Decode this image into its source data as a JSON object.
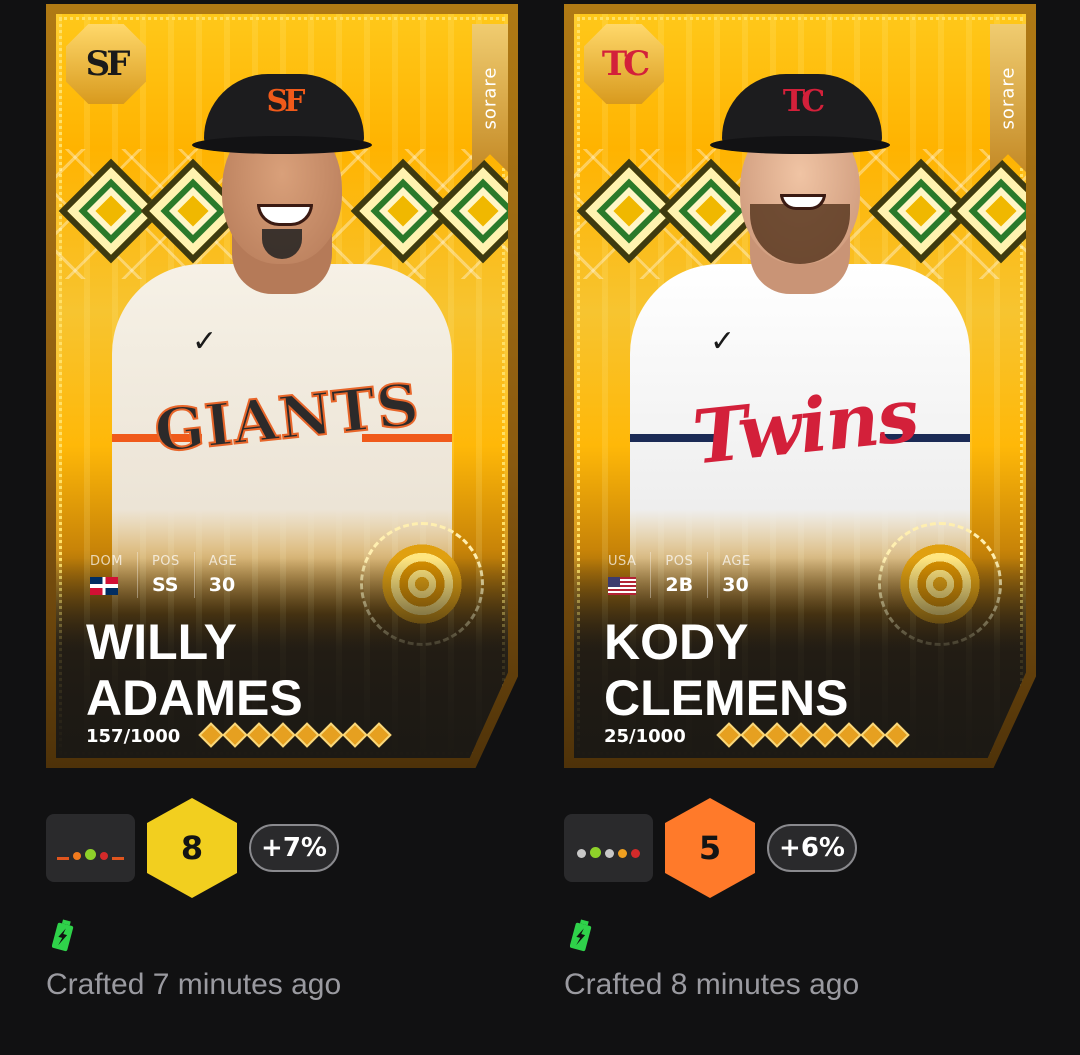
{
  "brand": "sorare",
  "cards": [
    {
      "team_logo_icon": "sf-giants-logo-icon",
      "team_logo_text": "SF",
      "team_color": "#f05a1a",
      "jersey_wordmark": "GIANTS",
      "nationality": "DOM",
      "pos_label": "POS",
      "position": "SS",
      "age_label": "AGE",
      "age": "30",
      "first_name": "WILLY",
      "last_name": "ADAMES",
      "serial": "157/1000",
      "form_dots": [
        "#e0551e",
        "#f07a1e",
        "#8ed12a",
        "#d42a2a",
        "#e0551e"
      ],
      "score": "8",
      "score_color": "#f2cf1f",
      "change": "+7%",
      "crafted": "Crafted 7 minutes ago"
    },
    {
      "team_logo_icon": "twins-logo-icon",
      "team_logo_text": "TC",
      "team_color": "#d3203a",
      "jersey_wordmark": "Twins",
      "nationality": "USA",
      "pos_label": "POS",
      "position": "2B",
      "age_label": "AGE",
      "age": "30",
      "first_name": "KODY",
      "last_name": "CLEMENS",
      "serial": "25/1000",
      "form_dots": [
        "#c8c8c8",
        "#8ed12a",
        "#c8c8c8",
        "#f0a020",
        "#d42a2a"
      ],
      "score": "5",
      "score_color": "#ff7a2a",
      "change": "+6%",
      "crafted": "Crafted 8 minutes ago"
    }
  ]
}
